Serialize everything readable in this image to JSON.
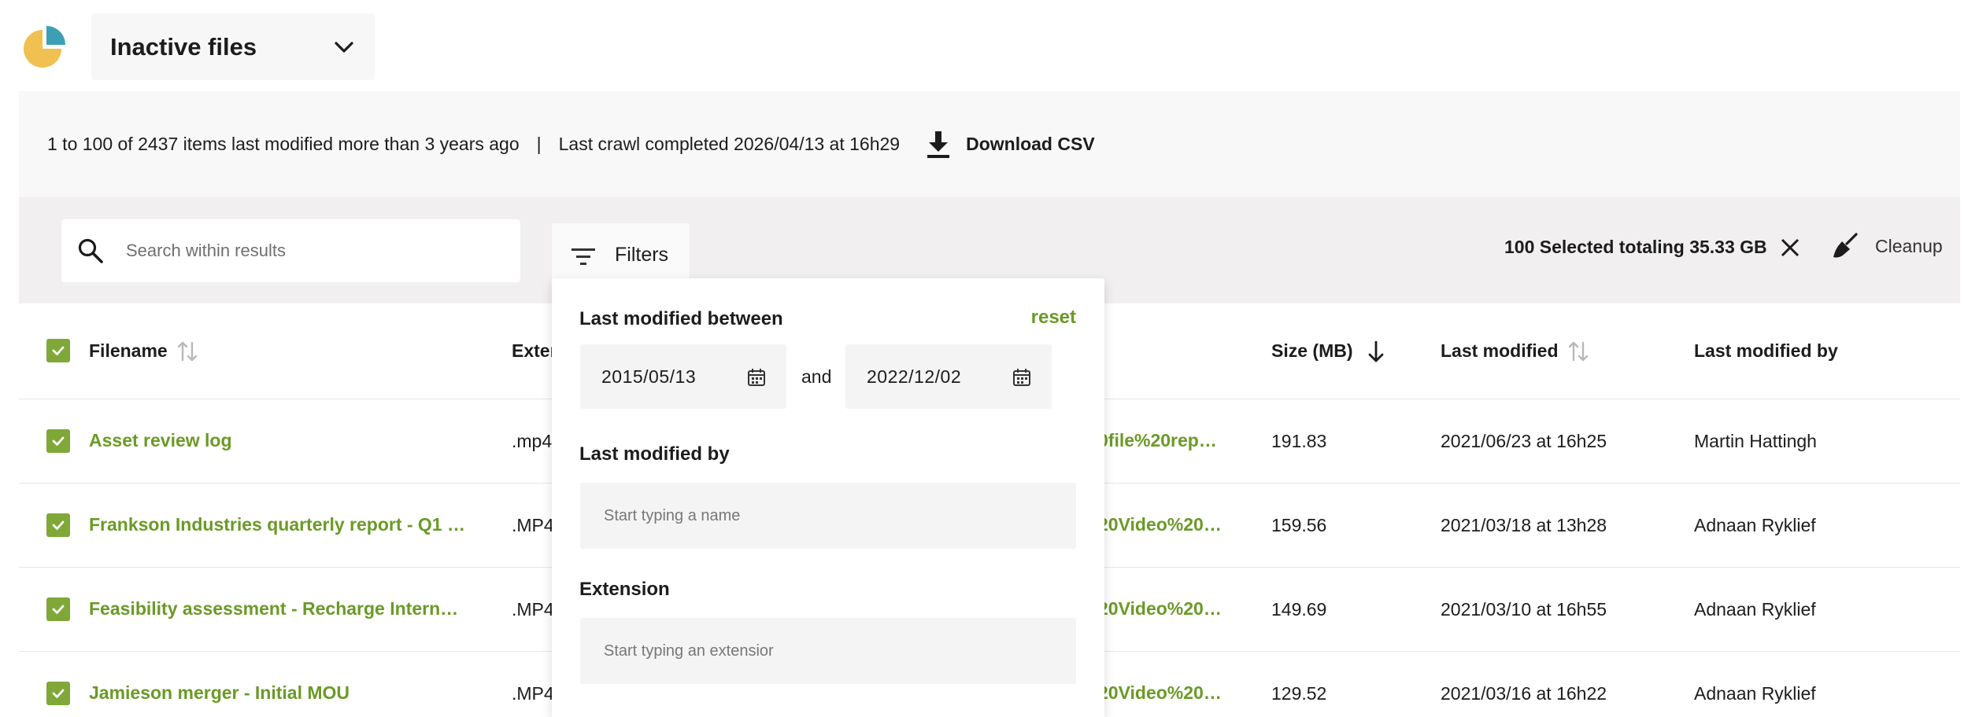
{
  "header": {
    "view_selected": "Inactive files"
  },
  "info": {
    "summary": "1 to 100 of 2437 items last modified more than 3 years ago",
    "separator": "|",
    "crawl": "Last crawl completed 2026/04/13 at 16h29",
    "download_label": "Download CSV"
  },
  "toolbar": {
    "search_placeholder": "Search within results",
    "filters_label": "Filters",
    "selection_summary": "100 Selected totaling 35.33 GB",
    "cleanup_label": "Cleanup"
  },
  "table": {
    "columns": {
      "filename": "Filename",
      "extension": "Exter",
      "size": "Size (MB)",
      "last_modified": "Last modified",
      "last_modified_by": "Last modified by"
    },
    "rows": [
      {
        "name": "Asset review log",
        "ext": ".mp4",
        "path": "0file%20rep…",
        "size": "191.83",
        "modified": "2021/06/23 at 16h25",
        "by": "Martin Hattingh"
      },
      {
        "name": "Frankson Industries quarterly report - Q1 2…",
        "ext": ".MP4",
        "path": "20Video%20…",
        "size": "159.56",
        "modified": "2021/03/18 at 13h28",
        "by": "Adnaan Ryklief"
      },
      {
        "name": "Feasibility assessment - Recharge Internati…",
        "ext": ".MP4",
        "path": "20Video%20…",
        "size": "149.69",
        "modified": "2021/03/10 at 16h55",
        "by": "Adnaan Ryklief"
      },
      {
        "name": "Jamieson merger - Initial MOU",
        "ext": ".MP4",
        "path": "20Video%20…",
        "size": "129.52",
        "modified": "2021/03/16 at 16h22",
        "by": "Adnaan Ryklief"
      }
    ]
  },
  "filter_panel": {
    "modified_between_label": "Last modified between",
    "reset_label": "reset",
    "date_from": "2015/05/13",
    "and_label": "and",
    "date_to": "2022/12/02",
    "modified_by_label": "Last modified by",
    "modified_by_placeholder": "Start typing a name",
    "extension_label": "Extension",
    "extension_placeholder": "Start typing an extensior"
  },
  "colors": {
    "accent_green": "#7fa839",
    "link_green": "#6a9a26",
    "logo_yellow": "#f0c050",
    "logo_teal": "#3d9fb5"
  }
}
